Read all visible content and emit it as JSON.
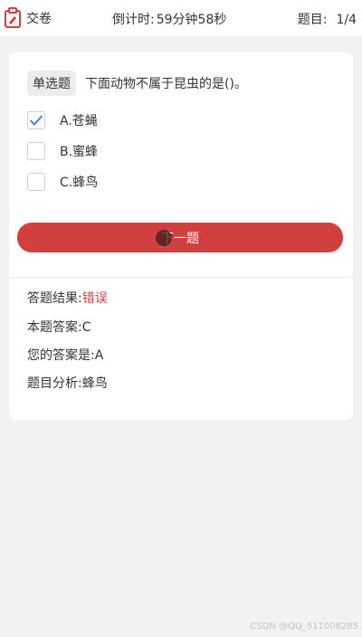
{
  "header": {
    "submit_label": "交卷",
    "timer_label": "倒计时:",
    "timer_value": "59分钟58秒",
    "counter_label": "题目:",
    "counter_value": "1/4"
  },
  "question": {
    "type": "单选题",
    "text": "下面动物不属于昆虫的是()。",
    "options": [
      {
        "label": "A.苍蝇",
        "checked": true
      },
      {
        "label": "B.蜜蜂",
        "checked": false
      },
      {
        "label": "C.蜂鸟",
        "checked": false
      }
    ]
  },
  "next_label": "下一题",
  "result": {
    "result_label": "答题结果:",
    "result_value": "错误",
    "correct_label": "本题答案:",
    "correct_value": "C",
    "user_label": "您的答案是:",
    "user_value": "A",
    "analysis_label": "题目分析:",
    "analysis_value": "蜂鸟"
  },
  "colors": {
    "accent": "#d23f3f",
    "check": "#2f7fd6"
  },
  "watermark": "CSDN @QQ_511008285"
}
